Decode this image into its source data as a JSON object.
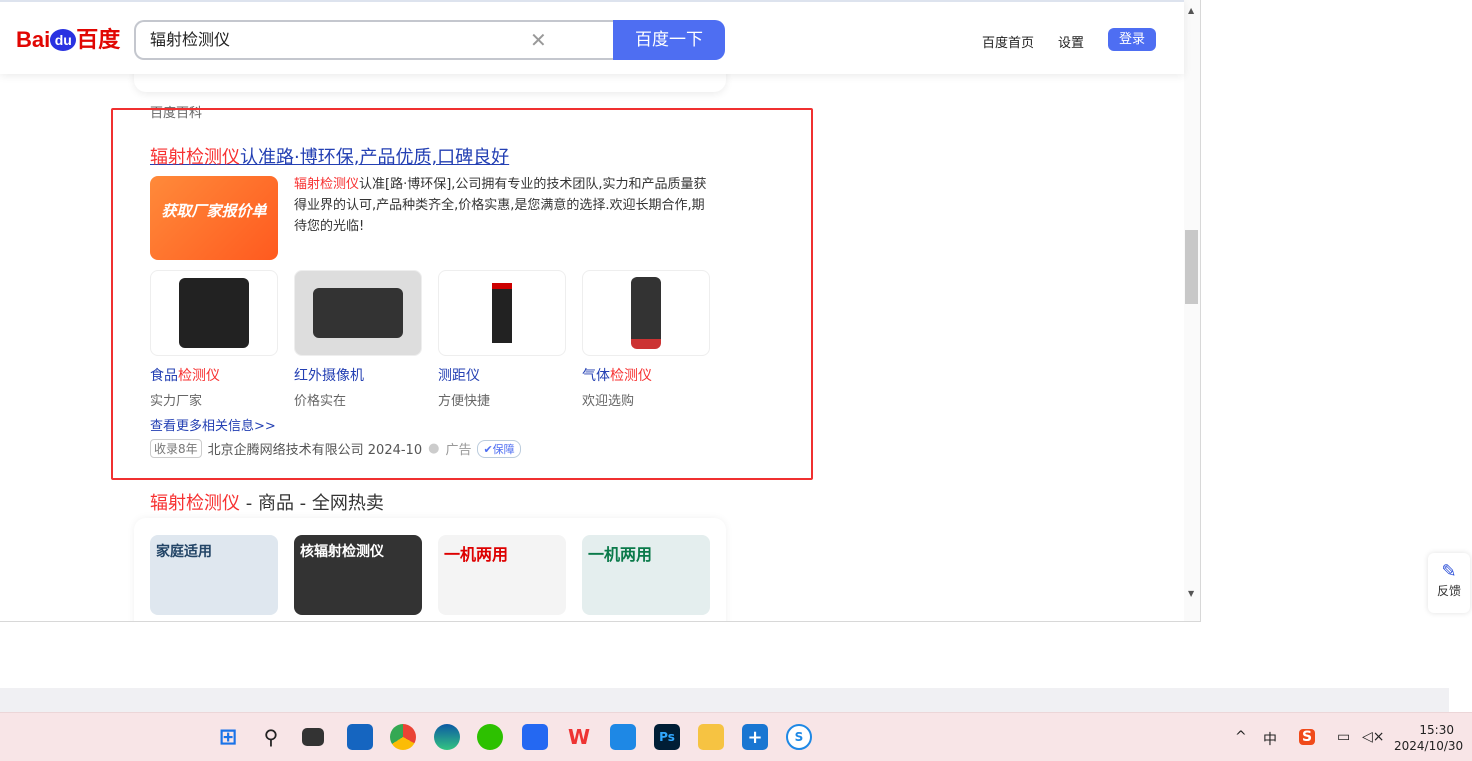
{
  "header": {
    "logo": "Bai du 百度",
    "logo_parts": [
      "Bai",
      "du",
      "百度"
    ],
    "query": "辐射检测仪",
    "search_button": "百度一下",
    "links": [
      "百度首页",
      "设置"
    ],
    "login": "登录"
  },
  "baike_label": "百度百科",
  "ad": {
    "title_red": "辐射检测仪",
    "title_rest": "认准路·博环保,产品优质,口碑良好",
    "banner": "获取厂家报价单",
    "desc_red": "辐射检测仪",
    "desc_rest": "认准[路·博环保],公司拥有专业的技术团队,实力和产品质量获得业界的认可,产品种类齐全,价格实惠,是您满意的选择.欢迎长期合作,期待您的光临!",
    "products": [
      {
        "name_a": "食品",
        "name_b": "检测仪",
        "sub": "实力厂家"
      },
      {
        "name_a": "红外摄像机",
        "name_b": "",
        "sub": "价格实在"
      },
      {
        "name_a": "测距仪",
        "name_b": "",
        "sub": "方便快捷"
      },
      {
        "name_a": "气体",
        "name_b": "检测仪",
        "sub": "欢迎选购"
      }
    ],
    "more": "查看更多相关信息>>",
    "tag": "收录8年",
    "company": "北京企腾网络技术有限公司 2024-10",
    "ad_label": "广告",
    "guarantee": "保障"
  },
  "goods": {
    "title_red": "辐射检测仪",
    "title_rest": " - 商品 - 全网热卖",
    "items": [
      "家庭适用",
      "核辐射检测仪",
      "一机两用",
      "一机两用"
    ]
  },
  "feedback": "反馈",
  "taskbar": {
    "tray_ime": "中",
    "time": "15:30",
    "date": "2024/10/30"
  }
}
